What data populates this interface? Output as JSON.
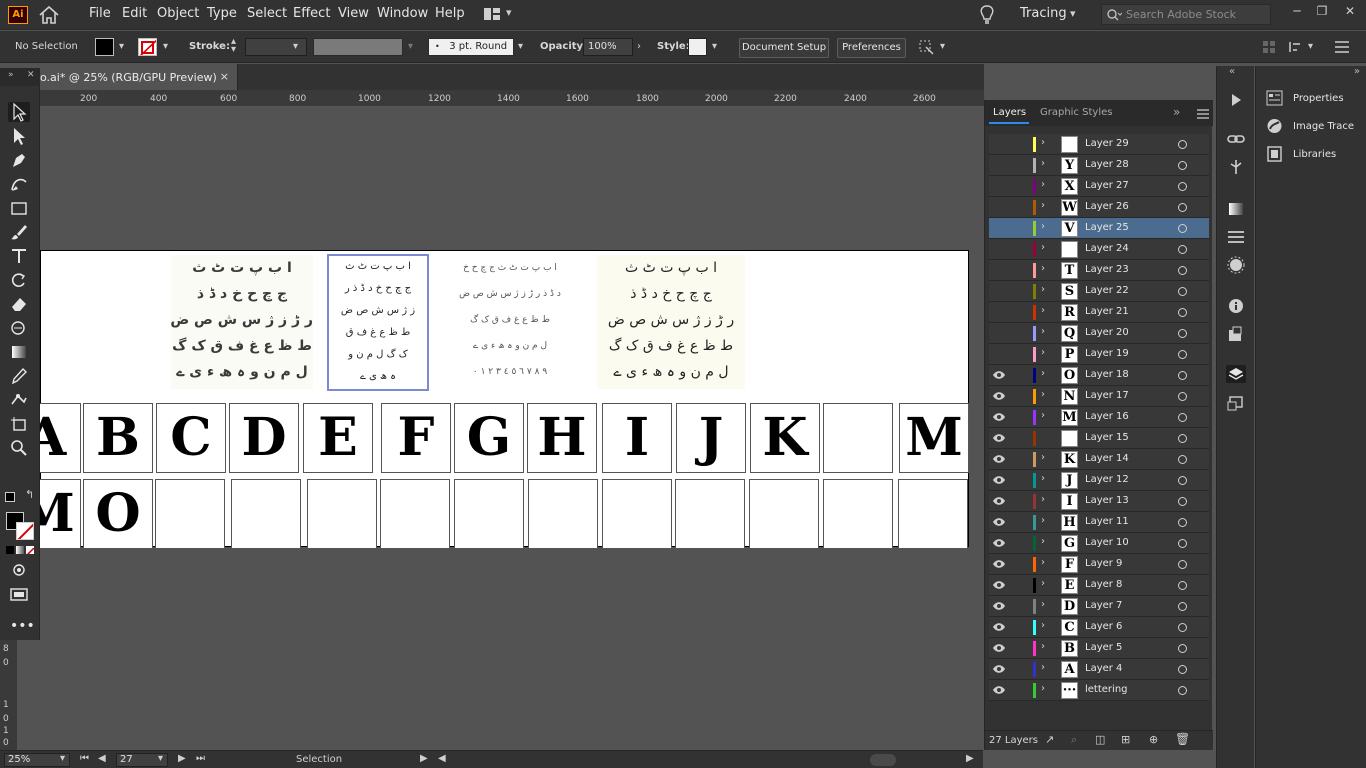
{
  "menubar": {
    "app_logo": "Ai",
    "items": [
      "File",
      "Edit",
      "Object",
      "Type",
      "Select",
      "Effect",
      "View",
      "Window",
      "Help"
    ],
    "workspace": "Tracing",
    "search_placeholder": "Search Adobe Stock"
  },
  "control": {
    "selection": "No Selection",
    "stroke_label": "Stroke:",
    "brush": "3 pt. Round",
    "opacity_label": "Opacity:",
    "opacity": "100%",
    "style_label": "Style:",
    "document_setup": "Document Setup",
    "preferences": "Preferences"
  },
  "document": {
    "tab_title": "o.ai* @ 25% (RGB/GPU Preview)",
    "close": "×"
  },
  "ruler": {
    "ticks": [
      "200",
      "400",
      "600",
      "800",
      "1000",
      "1200",
      "1400",
      "1600",
      "1800",
      "2000",
      "2200",
      "2400",
      "2600"
    ],
    "vticks": [
      "8",
      "0",
      "1",
      "0",
      "1",
      "0"
    ]
  },
  "artboard": {
    "urdu1": [
      "ا ب پ ت ٹ ث",
      "ج چ ح خ د ڈ ذ",
      "ر ڑ ز ژ س ش ص ض",
      "ط ظ ع غ ف ق ک گ",
      "ل م ن و ہ ھ ء ی ے"
    ],
    "urdu2": [
      "ا ب پ ت ٹ ث",
      "ج چ ح خ د ڈ ذ ر",
      "ز ژ س ش ص ض",
      "ط ظ ع غ ف ق",
      "ک گ ل م ن و",
      "ہ ھ ی ے"
    ],
    "urdu3": [
      "ا ب پ ت ٹ ث ج چ ح خ",
      "د ڈ ذ ر ڑ ز ژ س ش ص ض",
      "ط ظ ع غ ف ق ک گ",
      "ل م ن و ہ ھ ء ی ے",
      "٩ ٨ ٧ ٦ ٥ ٤ ٣ ٢ ١ ٠"
    ],
    "urdu4": [
      "ا ب پ ت ٹ ث",
      "ج چ ح خ د ڈ ذ",
      "ر ڑ ز ژ س ش ص ض",
      "ط ظ ع غ ف ق ک گ",
      "ل م ن و ہ ھ ء ی ے"
    ],
    "row1": [
      "A",
      "B",
      "C",
      "D",
      "E",
      "F",
      "G",
      "H",
      "I",
      "J",
      "K",
      "",
      "M"
    ],
    "row2": [
      "M",
      "O",
      "",
      "",
      "",
      "",
      "",
      "",
      "",
      "",
      "",
      "",
      ""
    ]
  },
  "status": {
    "zoom": "25%",
    "page": "27",
    "tool": "Selection"
  },
  "layers_panel": {
    "tab_layers": "Layers",
    "tab_graphic_styles": "Graphic Styles",
    "count": "27 Layers",
    "layers": [
      {
        "name": "Layer 29",
        "thumb": "",
        "color": "#ffff4d",
        "visible": false,
        "expand": true
      },
      {
        "name": "Layer 28",
        "thumb": "Y",
        "color": "#b3b3b3",
        "visible": false,
        "expand": true
      },
      {
        "name": "Layer 27",
        "thumb": "X",
        "color": "#800080",
        "visible": false,
        "expand": true
      },
      {
        "name": "Layer 26",
        "thumb": "W",
        "color": "#b35a00",
        "visible": false,
        "expand": true
      },
      {
        "name": "Layer 25",
        "thumb": "V",
        "color": "#99cc33",
        "visible": false,
        "expand": true,
        "selected": true
      },
      {
        "name": "Layer 24",
        "thumb": "",
        "color": "#99003d",
        "visible": false,
        "expand": true
      },
      {
        "name": "Layer 23",
        "thumb": "T",
        "color": "#ff9999",
        "visible": false,
        "expand": true
      },
      {
        "name": "Layer 22",
        "thumb": "S",
        "color": "#808000",
        "visible": false,
        "expand": true
      },
      {
        "name": "Layer 21",
        "thumb": "R",
        "color": "#cc3300",
        "visible": false,
        "expand": true
      },
      {
        "name": "Layer 20",
        "thumb": "Q",
        "color": "#9999ff",
        "visible": false,
        "expand": true
      },
      {
        "name": "Layer 19",
        "thumb": "P",
        "color": "#ff99cc",
        "visible": false,
        "expand": true
      },
      {
        "name": "Layer 18",
        "thumb": "O",
        "color": "#000080",
        "visible": true,
        "expand": true
      },
      {
        "name": "Layer 17",
        "thumb": "N",
        "color": "#ff9900",
        "visible": true,
        "expand": true
      },
      {
        "name": "Layer 16",
        "thumb": "M",
        "color": "#9933ff",
        "visible": true,
        "expand": true
      },
      {
        "name": "Layer 15",
        "thumb": "",
        "color": "#993300",
        "visible": true,
        "expand": false
      },
      {
        "name": "Layer 14",
        "thumb": "K",
        "color": "#cc9966",
        "visible": true,
        "expand": true
      },
      {
        "name": "Layer 12",
        "thumb": "J",
        "color": "#009999",
        "visible": true,
        "expand": true
      },
      {
        "name": "Layer 13",
        "thumb": "I",
        "color": "#993333",
        "visible": true,
        "expand": true
      },
      {
        "name": "Layer 11",
        "thumb": "H",
        "color": "#339999",
        "visible": true,
        "expand": true
      },
      {
        "name": "Layer 10",
        "thumb": "G",
        "color": "#006633",
        "visible": true,
        "expand": true
      },
      {
        "name": "Layer 9",
        "thumb": "F",
        "color": "#ff6600",
        "visible": true,
        "expand": true
      },
      {
        "name": "Layer 8",
        "thumb": "E",
        "color": "#000000",
        "visible": true,
        "expand": true
      },
      {
        "name": "Layer 7",
        "thumb": "D",
        "color": "#808080",
        "visible": true,
        "expand": true
      },
      {
        "name": "Layer 6",
        "thumb": "C",
        "color": "#33ffff",
        "visible": true,
        "expand": true
      },
      {
        "name": "Layer 5",
        "thumb": "B",
        "color": "#ff33cc",
        "visible": true,
        "expand": true
      },
      {
        "name": "Layer 4",
        "thumb": "A",
        "color": "#3333cc",
        "visible": true,
        "expand": true
      },
      {
        "name": "lettering",
        "thumb": "···",
        "color": "#33cc33",
        "visible": true,
        "expand": true
      }
    ]
  },
  "properties_panel": {
    "items": [
      "Properties",
      "Image Trace",
      "Libraries"
    ]
  },
  "colors": {
    "accent": "#2d8ceb",
    "selected_row": "#4b6b8f",
    "panel_bg": "#323232",
    "canvas_bg": "#535353"
  }
}
